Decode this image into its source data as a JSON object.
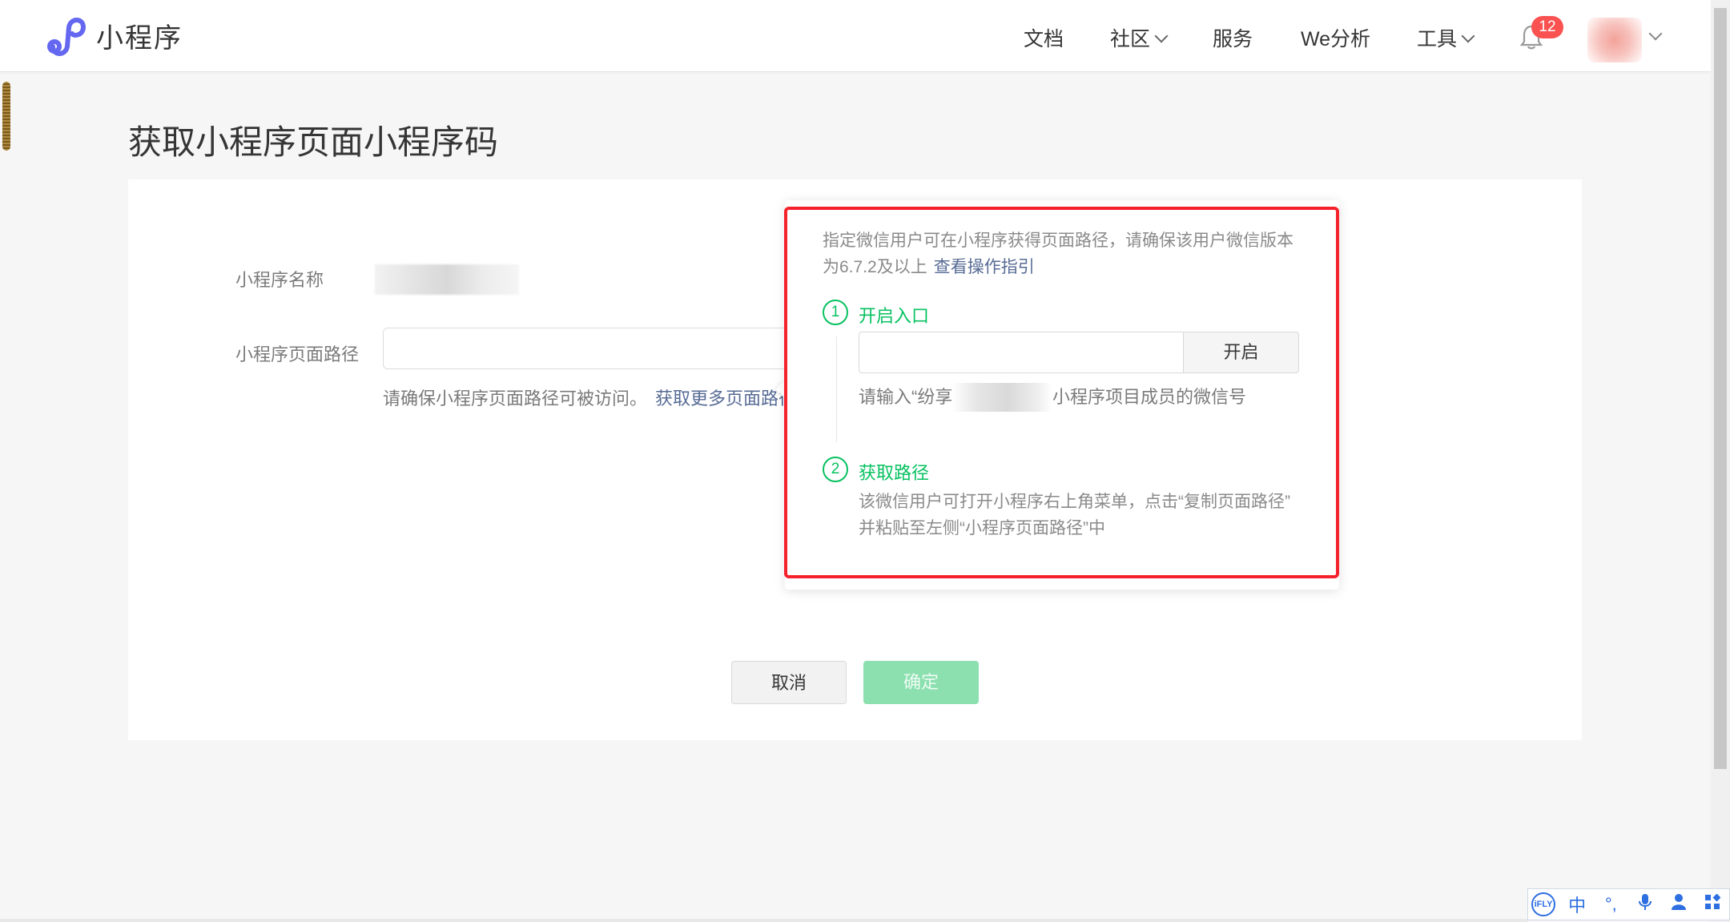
{
  "header": {
    "brand": "小程序",
    "nav": {
      "docs": "文档",
      "community": "社区",
      "services": "服务",
      "analytics": "We分析",
      "tools": "工具"
    },
    "notification_count": "12",
    "accent_color": "#07c160",
    "logo_color": "#6467f0"
  },
  "page": {
    "title": "获取小程序页面小程序码"
  },
  "form": {
    "name_label": "小程序名称",
    "path_label": "小程序页面路径",
    "path_value": "",
    "path_hint": "请确保小程序页面路径可被访问。",
    "path_more_link": "获取更多页面路径",
    "cancel": "取消",
    "confirm": "确定"
  },
  "popover": {
    "intro_line1": "指定微信用户可在小程序获得页面路径，请确保该用户微信版本",
    "intro_line2": "为6.7.2及以上",
    "guide_link": "查看操作指引",
    "step1": {
      "number": "1",
      "title": "开启入口",
      "input_value": "",
      "button": "开启",
      "hint_prefix": "请输入“纷享",
      "hint_suffix": "小程序项目成员的微信号"
    },
    "step2": {
      "number": "2",
      "title": "获取路径",
      "desc_line1": "该微信用户可打开小程序右上角菜单，点击“复制页面路径”",
      "desc_line2": "并粘贴至左侧“小程序页面路径”中"
    }
  },
  "ime_toolbar": {
    "logo": "iFLY",
    "mode": "中",
    "punct": "°,",
    "icons": [
      "ifly-logo-icon",
      "chinese-mode-icon",
      "punctuation-icon",
      "microphone-icon",
      "user-icon",
      "apps-grid-icon"
    ]
  },
  "highlight_color": "#f5222d"
}
